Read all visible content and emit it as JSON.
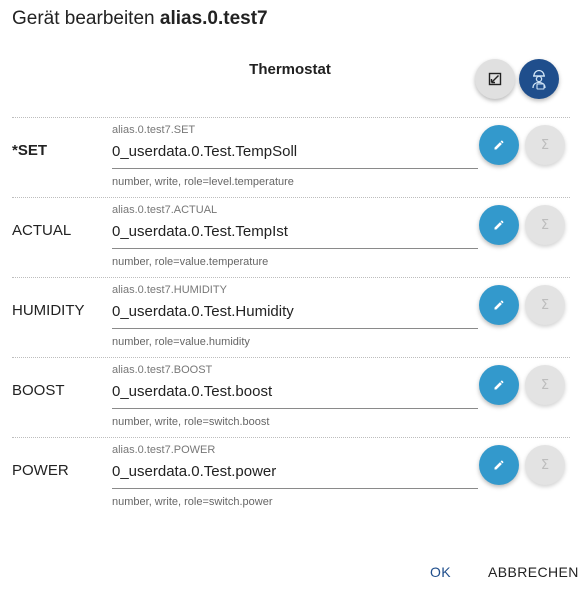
{
  "dialog": {
    "title_prefix": "Gerät bearbeiten",
    "title_id": "alias.0.test7",
    "device_type": "Thermostat"
  },
  "rows": [
    {
      "name": "*SET",
      "required": true,
      "alias_id": "alias.0.test7.SET",
      "object_id": "0_userdata.0.Test.TempSoll",
      "info": "number, write, role=level.temperature"
    },
    {
      "name": "ACTUAL",
      "required": false,
      "alias_id": "alias.0.test7.ACTUAL",
      "object_id": "0_userdata.0.Test.TempIst",
      "info": "number, role=value.temperature"
    },
    {
      "name": "HUMIDITY",
      "required": false,
      "alias_id": "alias.0.test7.HUMIDITY",
      "object_id": "0_userdata.0.Test.Humidity",
      "info": "number, role=value.humidity"
    },
    {
      "name": "BOOST",
      "required": false,
      "alias_id": "alias.0.test7.BOOST",
      "object_id": "0_userdata.0.Test.boost",
      "info": "number, write, role=switch.boost"
    },
    {
      "name": "POWER",
      "required": false,
      "alias_id": "alias.0.test7.POWER",
      "object_id": "0_userdata.0.Test.power",
      "info": "number, write, role=switch.power"
    }
  ],
  "icons": {
    "edit": "pencil-icon",
    "function": "sigma-icon",
    "expand": "resize-icon",
    "expert": "expert-person-icon"
  },
  "colors": {
    "primary_blue": "#3399cc",
    "navy": "#1f4e8c"
  },
  "footer": {
    "ok": "OK",
    "cancel": "ABBRECHEN"
  }
}
